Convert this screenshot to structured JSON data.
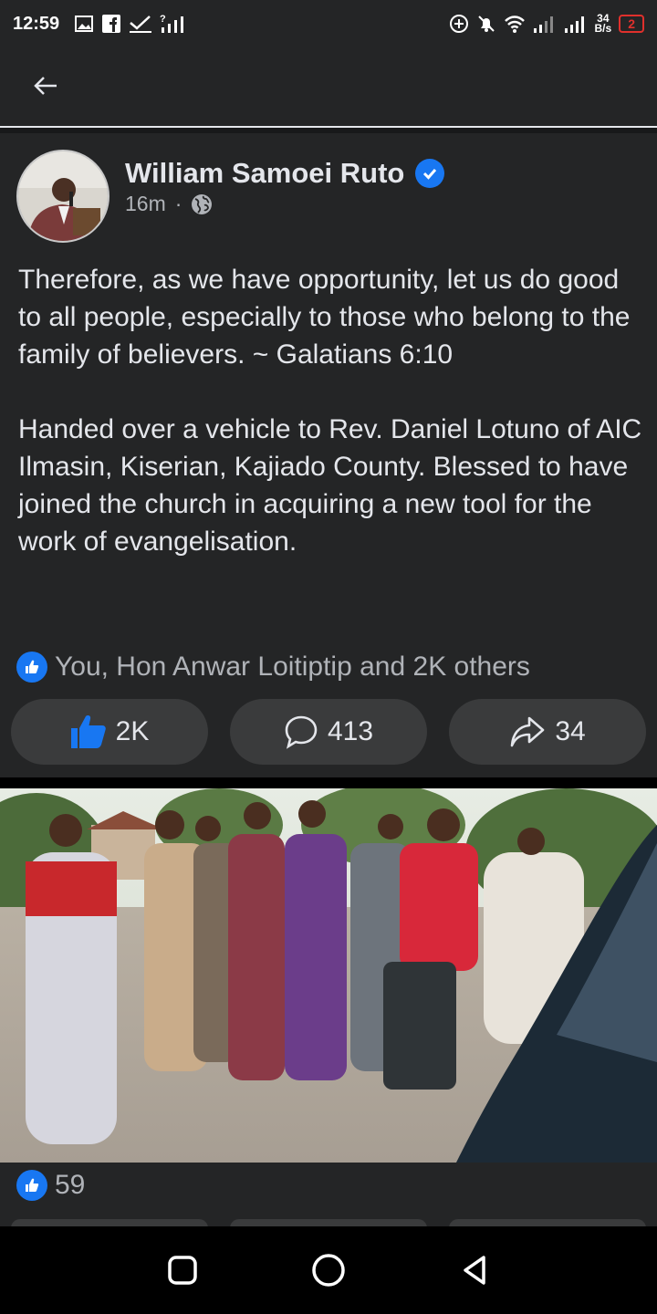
{
  "status_bar": {
    "time": "12:59",
    "net_speed_value": "34",
    "net_speed_unit": "B/s",
    "battery": "2",
    "left_icons": [
      "image-icon",
      "facebook-icon",
      "check-icon",
      "signal-unknown-icon"
    ],
    "right_icons": [
      "data-saver-icon",
      "mute-icon",
      "wifi-icon",
      "signal-icon",
      "signal-icon"
    ]
  },
  "app_bar": {
    "back_icon": "back-arrow-icon"
  },
  "post": {
    "author": "William Samoei Ruto",
    "verified": true,
    "time_ago": "16m",
    "separator": "·",
    "privacy_icon": "globe-icon",
    "paragraphs": [
      "Therefore, as we have opportunity, let us do good to all people, especially to those who belong to the family of believers. ~ Galatians 6:10",
      "Handed over a vehicle to Rev. Daniel Lotuno of AIC Ilmasin, Kiserian, Kajiado County. Blessed to have  joined the church in acquiring a new tool for the work of evangelisation."
    ],
    "reactions_summary": "You, Hon Anwar Loitiptip and 2K others",
    "actions": {
      "like_count": "2K",
      "comment_count": "413",
      "share_count": "34"
    }
  },
  "photo": {
    "likes": "59"
  },
  "colors": {
    "background": "#242526",
    "accent": "#1877f2",
    "button_bg": "#3a3b3c",
    "text_primary": "#e4e6eb",
    "text_secondary": "#b0b3b8",
    "battery_low": "#e0302c"
  },
  "nav_bar": {
    "icons": [
      "recents-icon",
      "home-icon",
      "back-icon"
    ]
  }
}
